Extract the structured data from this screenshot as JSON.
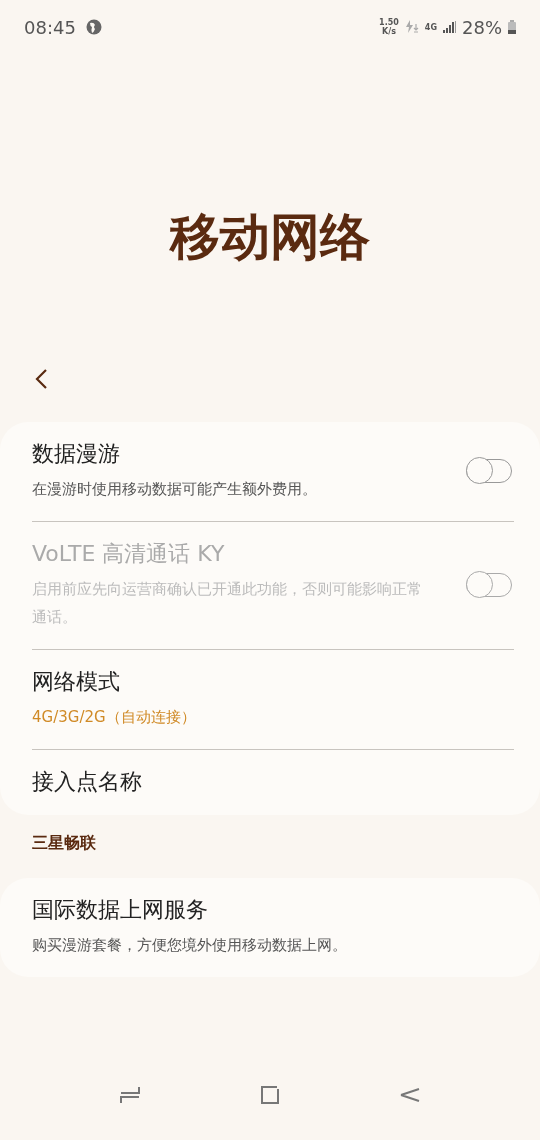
{
  "status_bar": {
    "time": "08:45",
    "speed": "1.50\nK/s",
    "network": "4G",
    "battery": "28%"
  },
  "title": "移动网络",
  "cards": [
    {
      "items": [
        {
          "kind": "toggle",
          "title": "数据漫游",
          "subtitle": "在漫游时使用移动数据可能产生额外费用。",
          "on": false,
          "disabled": false
        },
        {
          "kind": "toggle",
          "title": "VoLTE 高清通话 KY",
          "subtitle": "启用前应先向运营商确认已开通此功能，否则可能影响正常通话。",
          "on": false,
          "disabled": true
        },
        {
          "kind": "value",
          "title": "网络模式",
          "subtitle": "4G/3G/2G（自动连接）",
          "disabled": false
        },
        {
          "kind": "plain",
          "title": "接入点名称",
          "disabled": false
        }
      ]
    },
    {
      "header": "三星畅联",
      "items": [
        {
          "kind": "plain",
          "title": "国际数据上网服务",
          "subtitle": "购买漫游套餐，方便您境外使用移动数据上网。",
          "disabled": false
        }
      ]
    }
  ]
}
